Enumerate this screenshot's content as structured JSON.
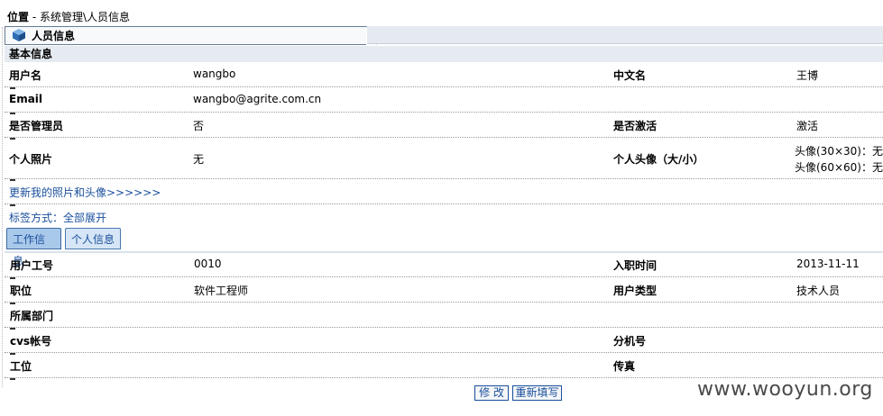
{
  "breadcrumb": {
    "label": "位置",
    "path": " - 系统管理\\人员信息"
  },
  "title": "人员信息",
  "section": "基本信息",
  "basic": {
    "username_label": "用户名",
    "username_value": "wangbo",
    "cn_label": "中文名",
    "cn_value": "王博",
    "email_label": "Email",
    "email_value": "wangbo@agrite.com.cn",
    "admin_label": "是否管理员",
    "admin_value": "否",
    "active_label": "是否激活",
    "active_value": "激活",
    "photo_label": "个人照片",
    "photo_value": "无",
    "avatar_label": "个人头像（大/小）",
    "avatar_big": "头像(30×30)：无",
    "avatar_small": "头像(60×60)：无"
  },
  "update_link": "更新我的照片和头像>>>>>>",
  "tag_mode": {
    "label": "标签方式：",
    "link": "全部展开"
  },
  "tabs": [
    "工作信息",
    "个人信息"
  ],
  "work": {
    "empno_label": "用户工号",
    "empno_value": "0010",
    "hire_label": "入职时间",
    "hire_value": "2013-11-11",
    "position_label": "职位",
    "position_value": "软件工程师",
    "usertype_label": "用户类型",
    "usertype_value": "技术人员",
    "dept_label": "所属部门",
    "cvs_label": "cvs帐号",
    "ext_label": "分机号",
    "seat_label": "工位",
    "fax_label": "传真"
  },
  "buttons": {
    "edit": "修 改",
    "reset": "重新填写"
  },
  "watermark": "www.wooyun.org",
  "colors": {
    "link": "#1a4f9c",
    "section_bg": "#e5ebf0",
    "tab_active": "#a9c9eb"
  }
}
